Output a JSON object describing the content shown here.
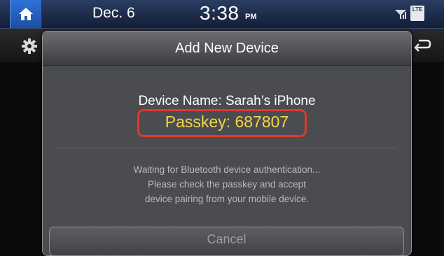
{
  "status_bar": {
    "date": "Dec.  6",
    "time": "3:38",
    "ampm": "PM",
    "lte_label": "LTE"
  },
  "dialog": {
    "title": "Add New Device",
    "device_name": "Device Name: Sarah’s iPhone",
    "passkey": "Passkey: 687807",
    "message_lines": [
      "Waiting for Bluetooth device authentication...",
      "Please check the passkey and accept",
      "device pairing from your mobile device."
    ],
    "cancel_label": "Cancel"
  },
  "colors": {
    "passkey_text": "#f2d64a",
    "highlight_border": "#e0392b",
    "home_button": "#2f72d6"
  },
  "icons": [
    "home-icon",
    "signal-icon",
    "lte-icon",
    "gear-icon",
    "back-icon"
  ]
}
